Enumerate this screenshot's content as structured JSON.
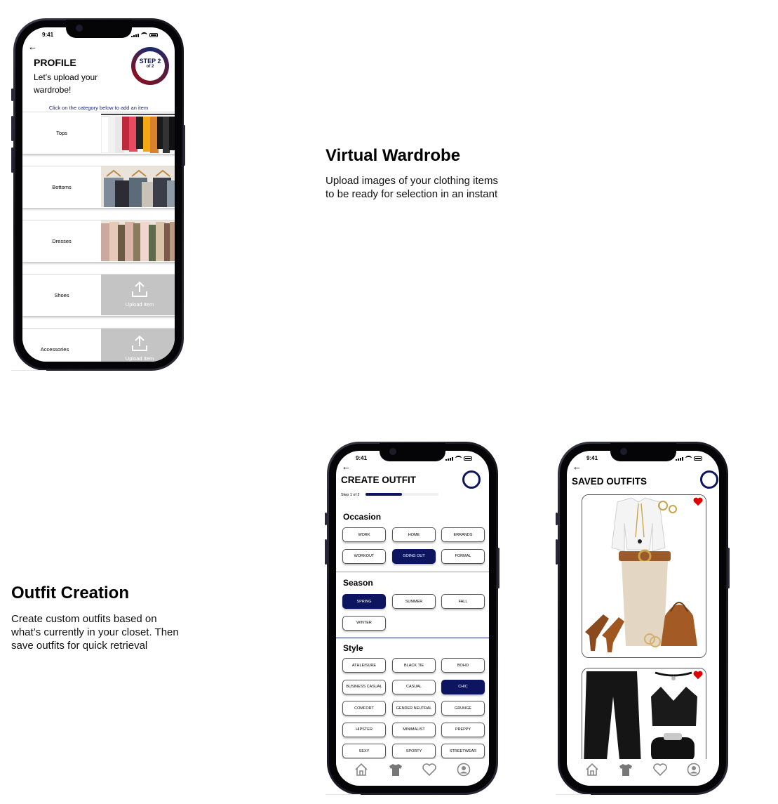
{
  "colors": {
    "navy": "#0d1560",
    "heart": "#e00000",
    "upload_gray": "#c4c4c4"
  },
  "features": [
    {
      "title": "Virtual Wardrobe",
      "desc": "Upload images of your clothing items to be ready for selection in an instant"
    },
    {
      "title": "Outfit Creation",
      "desc": "Create custom outfits based on what’s currently in your closet. Then save outfits for quick retrieval"
    }
  ],
  "status": {
    "time": "9:41"
  },
  "profile": {
    "title": "PROFILE",
    "subtitle": "Let’s upload your wardrobe!",
    "step_main": "STEP 2",
    "step_sub": "of 2",
    "hint": "Click on the category below to add an item",
    "upload_label": "Upload Item",
    "categories": [
      {
        "label": "Tops",
        "image": "tops-rack"
      },
      {
        "label": "Bottoms",
        "image": "bottoms-hangers"
      },
      {
        "label": "Dresses",
        "image": "dresses-rack"
      },
      {
        "label": "Shoes",
        "image": "upload"
      },
      {
        "label": "Accessories",
        "image": "upload"
      }
    ]
  },
  "create": {
    "title": "CREATE OUTFIT",
    "step_text": "Step 1 of 2",
    "progress": 0.5,
    "occasion": {
      "heading": "Occasion",
      "options": [
        "WORK",
        "HOME",
        "ERRANDS",
        "WORKOUT",
        "GOING OUT",
        "FORMAL"
      ],
      "selected": "GOING OUT"
    },
    "season": {
      "heading": "Season",
      "options": [
        "SPRING",
        "SUMMER",
        "FALL",
        "WINTER"
      ],
      "selected": "SPRING"
    },
    "style": {
      "heading": "Style",
      "options": [
        "ATHLEISURE",
        "BLACK TIE",
        "BOHO",
        "BUSINESS CASUAL",
        "CASUAL",
        "CHIC",
        "COMFORT",
        "GENDER NEUTRAL",
        "GRUNGE",
        "HIPSTER",
        "MINIMALIST",
        "PREPPY",
        "SEXY",
        "SPORTY",
        "STREETWEAR"
      ],
      "selected": "CHIC"
    }
  },
  "saved": {
    "title": "SAVED OUTFITS",
    "outfits": [
      {
        "favorited": true
      },
      {
        "favorited": true
      }
    ]
  },
  "tabbar": [
    "home-icon",
    "shirt-icon",
    "heart-icon",
    "profile-icon"
  ]
}
